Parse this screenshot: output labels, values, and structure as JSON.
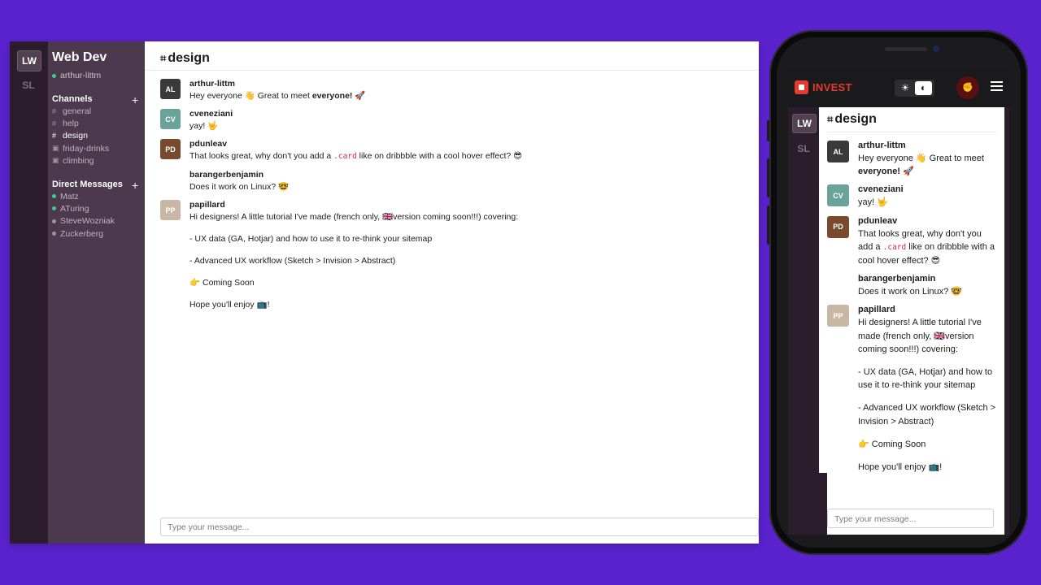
{
  "desktop": {
    "workspaces": [
      "LW",
      "SL"
    ],
    "team_name": "Web Dev",
    "current_user": "arthur-littm",
    "channels_title": "Channels",
    "channels": [
      {
        "label": "general",
        "icon": "hash-icon",
        "active": false
      },
      {
        "label": "help",
        "icon": "hash-icon",
        "active": false
      },
      {
        "label": "design",
        "icon": "hash-icon",
        "active": true
      },
      {
        "label": "friday-drinks",
        "icon": "lock-icon",
        "active": false
      },
      {
        "label": "climbing",
        "icon": "lock-icon",
        "active": false
      }
    ],
    "dm_title": "Direct Messages",
    "direct_messages": [
      {
        "label": "Matz",
        "online": true
      },
      {
        "label": "ATuring",
        "online": true
      },
      {
        "label": "SteveWozniak",
        "online": false
      },
      {
        "label": "Zuckerberg",
        "online": false
      }
    ],
    "add_symbol": "+",
    "channel_symbol": "⌗",
    "channel_title": "design",
    "composer_placeholder": "Type your message..."
  },
  "messages": [
    {
      "author": "arthur-littm",
      "avatar_color": "#3a3a3a",
      "initials": "AL",
      "parts": [
        "Hey everyone 👋 Great to meet ",
        "everyone!",
        " 🚀"
      ]
    },
    {
      "author": "cveneziani",
      "avatar_color": "#6aa39a",
      "initials": "CV",
      "text": "yay! 🤟"
    },
    {
      "author": "pdunleav",
      "avatar_color": "#7a4a2e",
      "initials": "PD",
      "parts": [
        "That looks great, why don't you add a ",
        ".card",
        " like on dribbble with a cool hover effect? 😎"
      ]
    },
    {
      "author": "barangerbenjamin",
      "text": "Does it work on Linux? 🤓"
    },
    {
      "author": "papillard",
      "avatar_color": "#c9b7a6",
      "initials": "PP",
      "paragraphs": [
        "Hi designers! A little tutorial I've made (french only, 🇬🇧version coming soon!!!) covering:",
        "- UX data (GA, Hotjar) and how to use it to re-think your sitemap",
        "- Advanced UX workflow (Sketch > Invision > Abstract)",
        "👉 Coming Soon",
        "Hope you'll enjoy 📺!"
      ]
    }
  ],
  "mobile": {
    "brand": "INVEST",
    "theme_toggle": {
      "light_icon": "☀",
      "dark_icon": "◐"
    },
    "avatar_icon": "user-avatar-icon",
    "avatar_glyph": "✊",
    "menu_icon": "hamburger-menu-icon",
    "workspaces": [
      "LW",
      "SL"
    ],
    "channel_title": "design",
    "composer_placeholder": "Type your message..."
  },
  "colors": {
    "background": "#5a22cf",
    "rail": "#2b1d2b",
    "sidebar": "#4d394d",
    "online": "#3bce8e",
    "code": "#e01e5a",
    "brand_red": "#e63a2e"
  }
}
